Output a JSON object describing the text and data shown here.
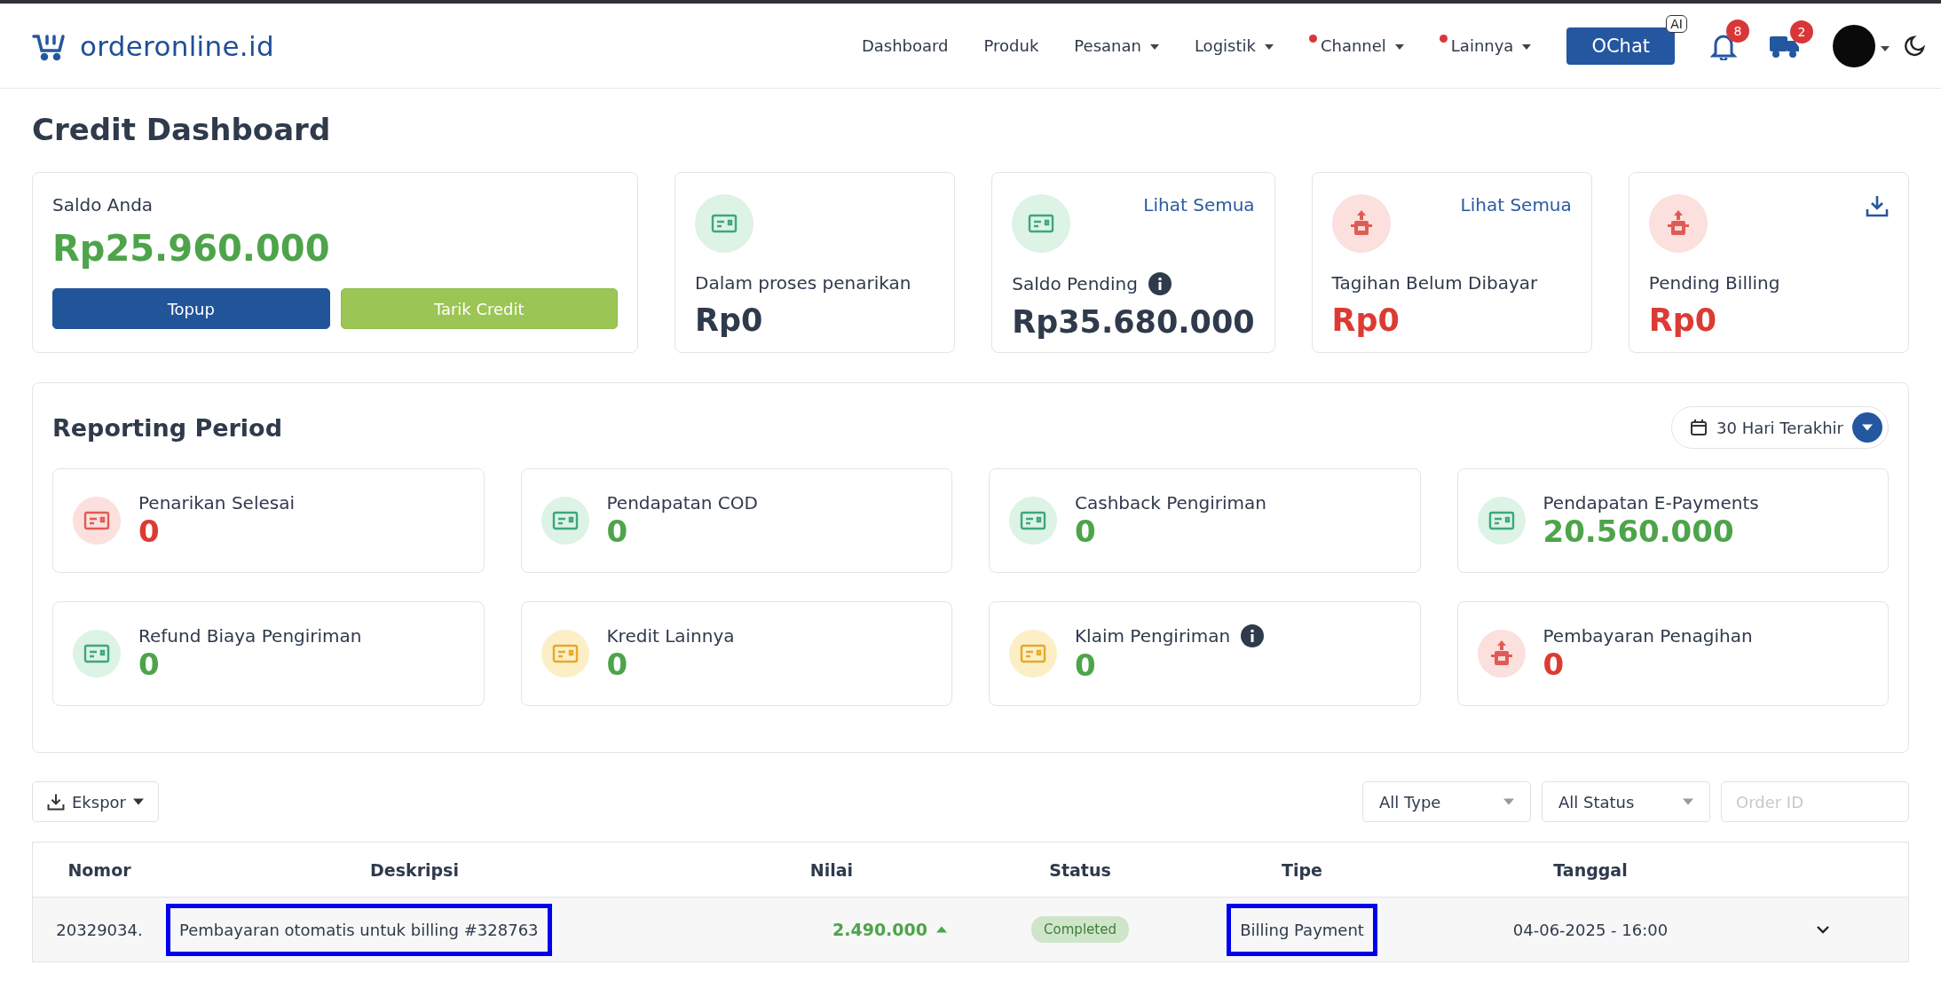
{
  "header": {
    "logo": "orderonline.id",
    "nav": [
      {
        "label": "Dashboard",
        "dropdown": false,
        "dot": false
      },
      {
        "label": "Produk",
        "dropdown": false,
        "dot": false
      },
      {
        "label": "Pesanan",
        "dropdown": true,
        "dot": false
      },
      {
        "label": "Logistik",
        "dropdown": true,
        "dot": false
      },
      {
        "label": "Channel",
        "dropdown": true,
        "dot": true
      },
      {
        "label": "Lainnya",
        "dropdown": true,
        "dot": true
      }
    ],
    "chat_button": {
      "label": "OChat",
      "badge": "AI"
    },
    "notifications": {
      "count": "8"
    },
    "deliveries": {
      "count": "2"
    }
  },
  "title": "Credit Dashboard",
  "balance": {
    "label": "Saldo Anda",
    "amount": "Rp25.960.000",
    "buttons": [
      {
        "label": "Topup",
        "kind": "primary"
      },
      {
        "label": "Tarik Credit",
        "kind": "success"
      }
    ]
  },
  "summary_cards": [
    {
      "kind": "withdraw",
      "label": "Dalam proses penarikan",
      "amount": "Rp0",
      "color": "#2f3a4b",
      "info": false
    },
    {
      "kind": "pending",
      "label": "Saldo Pending",
      "amount": "Rp35.680.000",
      "color": "#2f3a4b",
      "info": true,
      "link": "Lihat Semua"
    },
    {
      "kind": "bill",
      "label": "Tagihan Belum Dibayar",
      "amount": "Rp0",
      "color": "#dc3b33",
      "info": false,
      "link": "Lihat Semua"
    },
    {
      "kind": "bill",
      "label": "Pending Billing",
      "amount": "Rp0",
      "color": "#dc3b33",
      "info": false,
      "download": true
    }
  ],
  "reporting": {
    "title": "Reporting Period",
    "period": "30 Hari Terakhir",
    "stats": [
      {
        "kind": "withdraw-done",
        "label": "Penarikan Selesai",
        "value": "0",
        "color": "#dc3b33",
        "info": false
      },
      {
        "kind": "cod",
        "label": "Pendapatan COD",
        "value": "0",
        "color": "#4ea44a",
        "info": false
      },
      {
        "kind": "cashback",
        "label": "Cashback Pengiriman",
        "value": "0",
        "color": "#4ea44a",
        "info": false
      },
      {
        "kind": "epay",
        "label": "Pendapatan E-Payments",
        "value": "20.560.000",
        "color": "#4ea44a",
        "info": false
      },
      {
        "kind": "refund",
        "label": "Refund Biaya Pengiriman",
        "value": "0",
        "color": "#4ea44a",
        "info": false
      },
      {
        "kind": "credit",
        "label": "Kredit Lainnya",
        "value": "0",
        "color": "#4ea44a",
        "info": false
      },
      {
        "kind": "claim",
        "label": "Klaim Pengiriman",
        "value": "0",
        "color": "#4ea44a",
        "info": true
      },
      {
        "kind": "bill",
        "label": "Pembayaran Penagihan",
        "value": "0",
        "color": "#dc3b33",
        "info": false
      }
    ]
  },
  "toolbar": {
    "export": "Ekspor",
    "filters": [
      "All Type",
      "All Status"
    ],
    "order_id": {
      "placeholder": "Order ID"
    }
  },
  "table": {
    "columns": [
      "Nomor",
      "Deskripsi",
      "Nilai",
      "Status",
      "Tipe",
      "Tanggal"
    ],
    "rows": [
      {
        "nomor": "20329034.",
        "deskripsi": {
          "text": "Pembayaran otomatis untuk billing #328763",
          "highlighted": true
        },
        "nilai": "2.490.000",
        "increase": true,
        "status": "Completed",
        "tipe": {
          "text": "Billing Payment",
          "highlighted": true
        },
        "tanggal": "04-06-2025 - 16:00",
        "expanded": false
      }
    ]
  }
}
